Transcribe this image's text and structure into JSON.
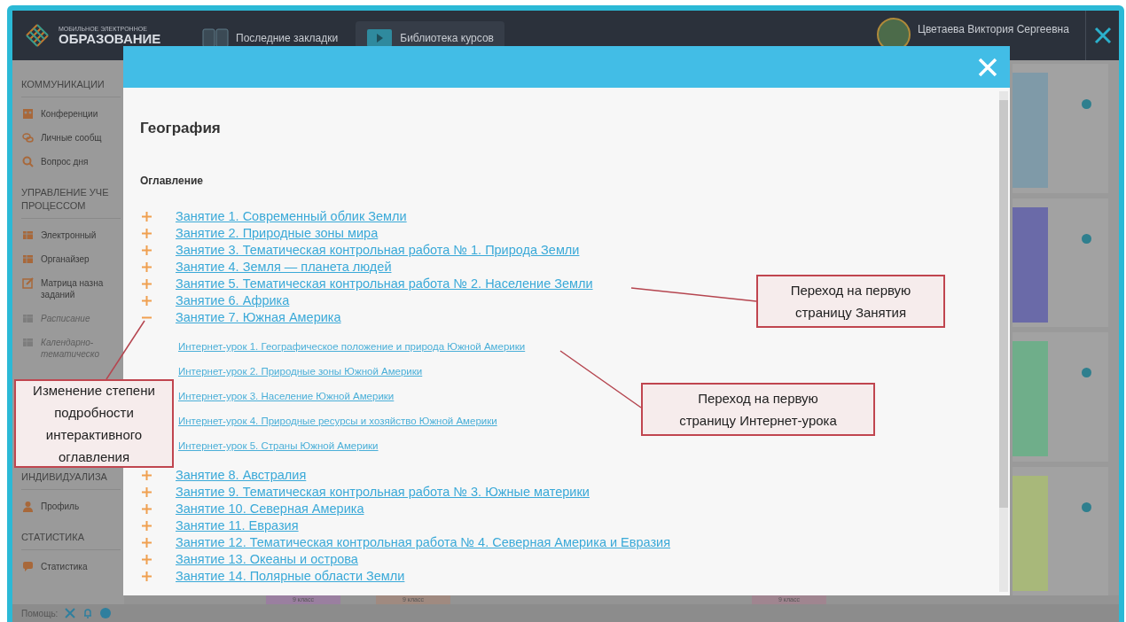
{
  "header": {
    "logo": {
      "small": "МОБИЛЬНОЕ ЭЛЕКТРОННОЕ",
      "big": "ОБРАЗОВАНИЕ"
    },
    "tabs": [
      {
        "label": "Последние закладки",
        "selected": false
      },
      {
        "label": "Библиотека курсов",
        "selected": true
      }
    ],
    "user": {
      "name": "Цветаева Виктория Сергеевна"
    }
  },
  "sidebar": {
    "sections": [
      {
        "title": "КОММУНИКАЦИИ",
        "items": [
          {
            "label": "Конференции",
            "disabled": false
          },
          {
            "label": "Личные сообщ",
            "disabled": false
          },
          {
            "label": "Вопрос дня",
            "disabled": false
          }
        ]
      },
      {
        "title": "УПРАВЛЕНИЕ УЧЕ ПРОЦЕССОМ",
        "items": [
          {
            "label": "Электронный",
            "disabled": false
          },
          {
            "label": "Органайзер",
            "disabled": false
          },
          {
            "label": "Матрица назна заданий",
            "disabled": false
          },
          {
            "label": "Расписание",
            "disabled": true
          },
          {
            "label": "Календарно-тематическо",
            "disabled": true
          }
        ]
      },
      {
        "title": "ИНДИВИДУАЛИЗА",
        "items": [
          {
            "label": "Профиль",
            "disabled": false
          }
        ]
      },
      {
        "title": "СТАТИСТИКА",
        "items": [
          {
            "label": "Статистика",
            "disabled": false
          }
        ]
      }
    ]
  },
  "grade_tags": [
    "9 класс",
    "9 класс",
    "9 класс"
  ],
  "status_bar": {
    "help_label": "Помощь:"
  },
  "modal": {
    "title": "География",
    "toc_heading": "Оглавление",
    "lessons": [
      {
        "title": "Занятие 1. Современный облик Земли",
        "expanded": false
      },
      {
        "title": "Занятие 2. Природные зоны мира",
        "expanded": false
      },
      {
        "title": "Занятие 3. Тематическая контрольная работа № 1. Природа Земли",
        "expanded": false
      },
      {
        "title": "Занятие 4. Земля — планета людей",
        "expanded": false
      },
      {
        "title": "Занятие 5. Тематическая контрольная работа № 2. Население Земли",
        "expanded": false
      },
      {
        "title": "Занятие 6. Африка",
        "expanded": false
      },
      {
        "title": "Занятие 7. Южная Америка",
        "expanded": true,
        "children": [
          {
            "title": "Интернет-урок 1. Географическое положение и природа Южной Америки"
          },
          {
            "title": "Интернет-урок 2. Природные зоны Южной Америки"
          },
          {
            "title": "Интернет-урок 3. Население Южной Америки"
          },
          {
            "title": "Интернет-урок 4. Природные ресурсы и хозяйство Южной Америки"
          },
          {
            "title": "Интернет-урок 5. Страны Южной Америки"
          }
        ]
      },
      {
        "title": "Занятие 8. Австралия",
        "expanded": false
      },
      {
        "title": "Занятие 9. Тематическая контрольная работа № 3. Южные материки",
        "expanded": false
      },
      {
        "title": "Занятие 10. Северная Америка",
        "expanded": false
      },
      {
        "title": "Занятие 11. Евразия",
        "expanded": false
      },
      {
        "title": "Занятие 12. Тематическая контрольная работа № 4. Северная Америка и Евразия",
        "expanded": false
      },
      {
        "title": "Занятие 13. Океаны и острова",
        "expanded": false
      },
      {
        "title": "Занятие 14. Полярные области Земли",
        "expanded": false
      }
    ]
  },
  "annotations": [
    {
      "text": "Переход на первую страницу Занятия"
    },
    {
      "text": "Изменение степени подробности интерактивного оглавления"
    },
    {
      "text": "Переход на первую страницу Интернет-урока"
    }
  ]
}
